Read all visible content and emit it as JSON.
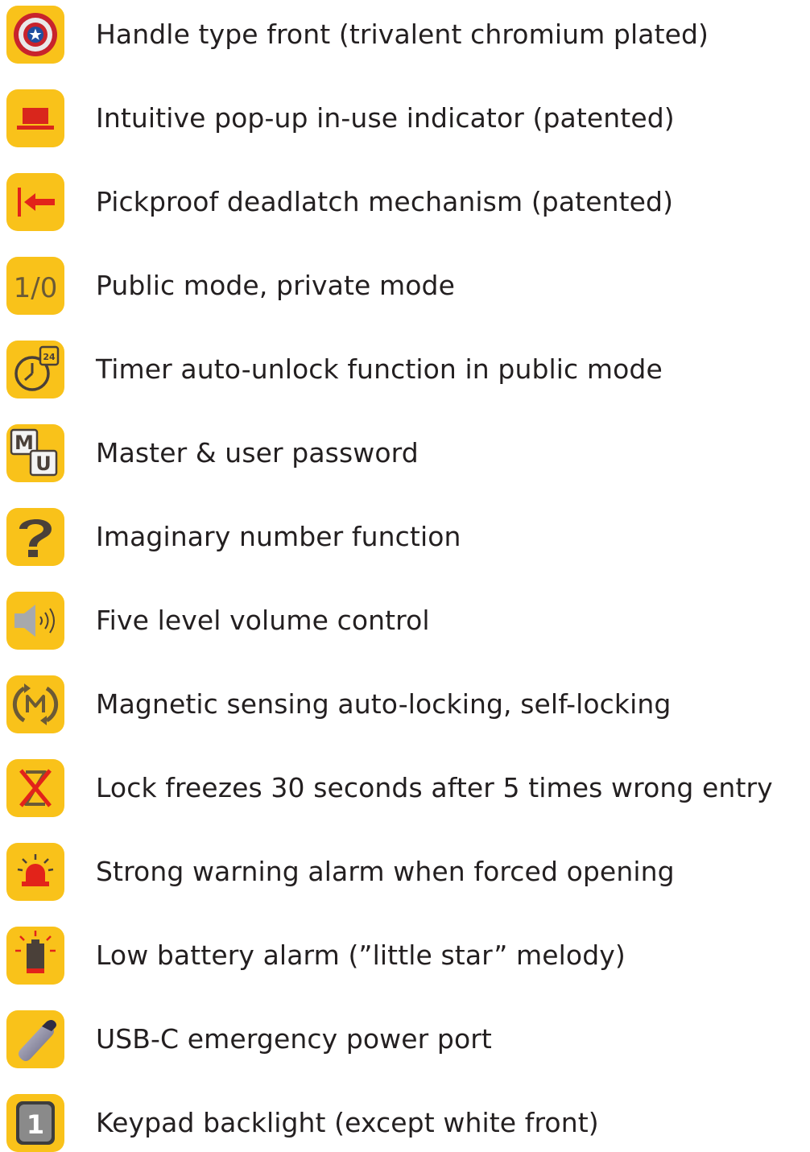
{
  "features": [
    {
      "icon": "shield-icon",
      "label": "Handle type front (trivalent chromium plated)"
    },
    {
      "icon": "indicator-icon",
      "label": "Intuitive pop-up in-use indicator (patented)"
    },
    {
      "icon": "deadlatch-icon",
      "label": "Pickproof deadlatch mechanism (patented)"
    },
    {
      "icon": "mode-icon",
      "label": "Public mode, private mode"
    },
    {
      "icon": "timer-icon",
      "label": "Timer auto-unlock function in public mode"
    },
    {
      "icon": "password-icon",
      "label": "Master & user password"
    },
    {
      "icon": "question-icon",
      "label": "Imaginary number function"
    },
    {
      "icon": "volume-icon",
      "label": "Five level volume control"
    },
    {
      "icon": "magnet-icon",
      "label": "Magnetic sensing auto-locking, self-locking"
    },
    {
      "icon": "freeze-icon",
      "label": "Lock freezes 30 seconds after 5 times wrong entry"
    },
    {
      "icon": "alarm-icon",
      "label": "Strong warning alarm when forced opening"
    },
    {
      "icon": "battery-icon",
      "label": "Low battery alarm (”little star” melody)"
    },
    {
      "icon": "usb-icon",
      "label": "USB-C emergency power port"
    },
    {
      "icon": "keypad-icon",
      "label": "Keypad backlight (except white front)"
    }
  ],
  "icon_text": {
    "mode": "1/0",
    "timer": "24",
    "master": "M",
    "user": "U",
    "keypad": "1"
  },
  "colors": {
    "tile": "#f9c21a",
    "text": "#231f20",
    "accent_red": "#e2231a"
  }
}
